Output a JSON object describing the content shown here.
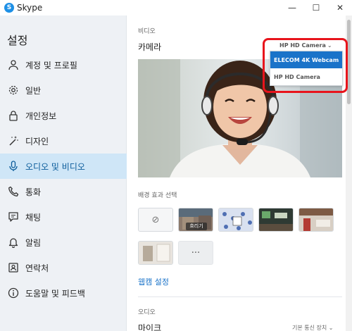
{
  "titlebar": {
    "app_icon_letter": "S",
    "title": "Skype",
    "minimize_glyph": "—",
    "maximize_glyph": "☐",
    "close_glyph": "✕"
  },
  "sidebar": {
    "title": "설정",
    "items": [
      {
        "label": "계정 및 프로필",
        "icon": "person-icon"
      },
      {
        "label": "일반",
        "icon": "gear-icon"
      },
      {
        "label": "개인정보",
        "icon": "lock-icon"
      },
      {
        "label": "디자인",
        "icon": "magic-wand-icon"
      },
      {
        "label": "오디오 및 비디오",
        "icon": "microphone-icon",
        "active": true
      },
      {
        "label": "통화",
        "icon": "phone-icon"
      },
      {
        "label": "채팅",
        "icon": "chat-icon"
      },
      {
        "label": "알림",
        "icon": "bell-icon"
      },
      {
        "label": "연락처",
        "icon": "contact-card-icon"
      },
      {
        "label": "도움말 및 피드백",
        "icon": "info-icon"
      }
    ]
  },
  "main": {
    "video_section_label": "비디오",
    "camera_label": "카메라",
    "camera_selected": "HP HD Camera",
    "camera_options": [
      "ELECOM 4K Webcam",
      "HP HD Camera"
    ],
    "camera_highlighted": "ELECOM 4K Webcam",
    "background_effects_label": "배경 효과 선택",
    "blur_caption": "흐리기",
    "more_glyph": "···",
    "none_glyph": "⊘",
    "webcam_settings_link": "웹캠 설정",
    "audio_section_label": "오디오",
    "mic_label": "마이크",
    "mic_device": "기본 통신 장치"
  },
  "colors": {
    "accent": "#1a73c9",
    "sidebar_bg": "#eef1f5",
    "active_bg": "#cfe6f7",
    "highlight_red": "#e8141c"
  }
}
